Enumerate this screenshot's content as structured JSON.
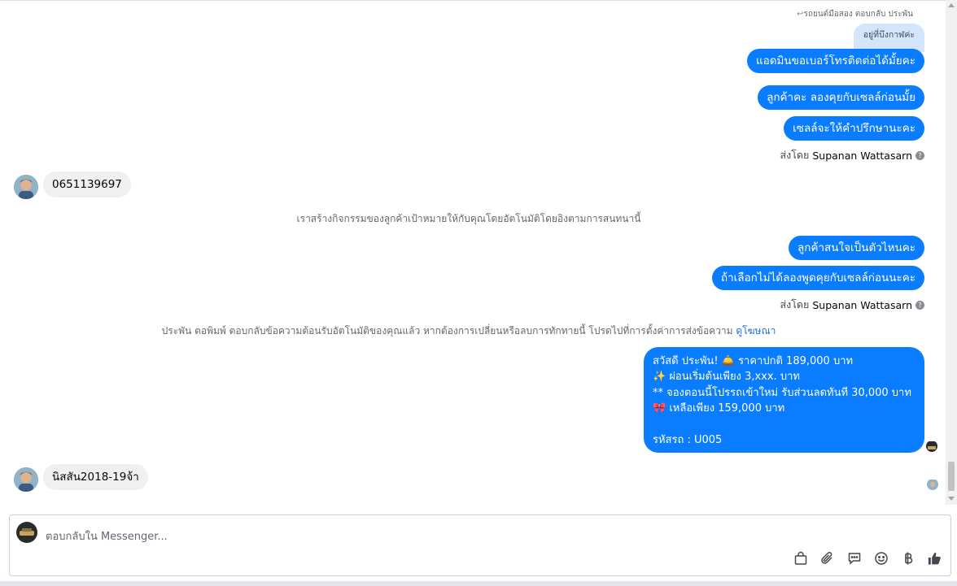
{
  "messages": {
    "reply_context": "รถยนต์มือสอง ตอบกลับ ประพัน",
    "reply_quote": "อยู่ที่บึงกาฬค่ะ",
    "out1": "แอดมินขอเบอร์โทรติดต่อได้มั้ยคะ",
    "out2": "ลูกค้าคะ ลองคุยกับเซลล์ก่อนมั้ย",
    "out3": "เซลล์จะให้คำปรึกษานะคะ",
    "sent_by_label_1": "ส่งโดย",
    "sent_by_name_1": "Supanan Wattasarn",
    "in1": "0651139697",
    "system1": "เราสร้างกิจกรรมของลูกค้าเป้าหมายให้กับคุณโดยอัตโนมัติโดยอิงตามการสนทนานี้",
    "out4": "ลูกค้าสนใจเป็นตัวไหนคะ",
    "out5": "ถ้าเลือกไม่ได้ลองพูดคุยกับเซลล์ก่อนนะคะ",
    "sent_by_label_2": "ส่งโดย",
    "sent_by_name_2": "Supanan Wattasarn",
    "system2": "ประพัน ตอพิมพ์ ตอบกลับข้อความต้อนรับอัตโนมัติของคุณแล้ว หากต้องการเปลี่ยนหรือลบการทักทายนี้ โปรดไปที่การตั้งค่าการส่งข้อความ",
    "system2_link": "ดูโฆษณา",
    "auto_reply": {
      "line1": "สวัสดี ประพัน! 🛎️ ราคาปกติ  189,000 บาท",
      "line2": "✨  ผ่อนเริ่มต้นเพียง 3,xxx. บาท",
      "line3": "** จองตอนนี้โปรรถเข้าใหม่ รับส่วนลดทันที 30,000 บาท",
      "line4": "🎀  เหลือเพียง 159,000 บาท",
      "line5": "",
      "line6": " รหัสรถ : U005"
    },
    "in2": "นิสสัน2018-19จ้า"
  },
  "composer": {
    "placeholder": "ตอบกลับใน Messenger..."
  },
  "toolbar": {
    "icons": [
      "shopping-bag-icon",
      "attachment-icon",
      "saved-reply-icon",
      "emoji-icon",
      "baht-icon",
      "like-icon"
    ]
  },
  "colors": {
    "outgoing_bubble": "#0a7cff",
    "incoming_bubble": "#f0f0f0",
    "link": "#216fdb"
  }
}
